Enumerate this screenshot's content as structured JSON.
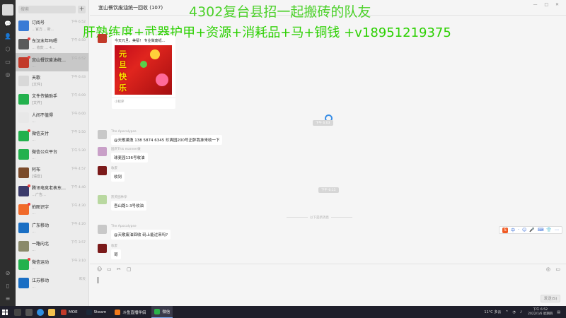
{
  "window": {
    "title": "宜山餐饮废油统一回收 (107)",
    "controls": "— □ ✕"
  },
  "overlays": {
    "line1": "4302复台县招一起搬砖的队友",
    "line2": "肝熟练度+武器护甲+资源+消耗品+马+铜钱 +v18951219375"
  },
  "rail": {
    "icons": [
      "chat-icon",
      "contacts-icon",
      "favorites-icon",
      "files-icon",
      "moments-icon"
    ],
    "bottom_icons": [
      "phone-icon",
      "settings-icon",
      "menu-icon"
    ]
  },
  "search": {
    "placeholder": "搜索",
    "add_label": "+"
  },
  "conversations": [
    {
      "name": "订阅号",
      "preview": "…官方… 新…",
      "time": "下午 6:52",
      "color": "#3a7bd5",
      "unread": false
    },
    {
      "name": "东汉末年吗嗯",
      "preview": "… 收款 … 4…",
      "time": "下午 6:50",
      "color": "#5a5a5a",
      "unread": true
    },
    {
      "name": "宜山餐饮废油统…",
      "preview": "…",
      "time": "下午 6:52",
      "color": "#c23a2a",
      "unread": true
    },
    {
      "name": "天歌",
      "preview": "[文件]",
      "time": "下午 6:43",
      "color": "#d8d8d8",
      "unread": false
    },
    {
      "name": "文件传输助手",
      "preview": "[文件]",
      "time": "下午 6:09",
      "color": "#23b14d",
      "unread": false
    },
    {
      "name": "人间不值得",
      "preview": "…",
      "time": "下午 6:00",
      "color": "#e8e8e8",
      "unread": false
    },
    {
      "name": "微信支付",
      "preview": "…",
      "time": "下午 5:50",
      "color": "#23b14d",
      "unread": true
    },
    {
      "name": "微信公众平台",
      "preview": "…",
      "time": "下午 5:30",
      "color": "#23b14d",
      "unread": false
    },
    {
      "name": "阿布",
      "preview": "[语音]",
      "time": "下午 4:57",
      "color": "#7b4b2a",
      "unread": false
    },
    {
      "name": "腾讯电竞老表东…",
      "preview": "…广告…",
      "time": "下午 4:40",
      "color": "#3b3b6b",
      "unread": true
    },
    {
      "name": "拍图识字",
      "preview": "…",
      "time": "下午 4:30",
      "color": "#f06a2a",
      "unread": true
    },
    {
      "name": "广东移动",
      "preview": "…",
      "time": "下午 4:20",
      "color": "#1a6fc4",
      "unread": false
    },
    {
      "name": "一路向北",
      "preview": "…",
      "time": "下午 3:57",
      "color": "#8a8a6a",
      "unread": false
    },
    {
      "name": "微信运动",
      "preview": "…",
      "time": "下午 3:10",
      "color": "#23b14d",
      "unread": true
    },
    {
      "name": "江苏移动",
      "preview": "…",
      "time": "昨天",
      "color": "#1a6fc4",
      "unread": false
    }
  ],
  "card": {
    "title": "今天元旦，美鄢！ 专业做废纸…",
    "chars": [
      "元",
      "旦",
      "快",
      "乐"
    ],
    "source": "小程序"
  },
  "messages": [
    {
      "sender": "The Apocalypse",
      "text": "@天歌袭渔 138 5874 6345 珍爽园200号正胖我抹来收一下",
      "avatar": "#c8c8c8"
    },
    {
      "sender": "国庆This manner做",
      "text": "球麦园136号收油",
      "avatar": "#c9a0c8"
    },
    {
      "sender": "收废",
      "text": "收到",
      "avatar": "#7b1a1a"
    },
    {
      "sender": "凯英园林亭",
      "text": "吾山路1-3号收油",
      "avatar": "#b9d8a0"
    },
    {
      "sender": "The Apocalypse",
      "text": "@天歌废油回收 码上能过来吗?",
      "avatar": "#c8c8c8"
    },
    {
      "sender": "收废",
      "text": "哥",
      "avatar": "#7b1a1a"
    }
  ],
  "time_labels": [
    "下午 6:03",
    "下午 6:11"
  ],
  "new_messages_divider": "以下是新消息",
  "ime": {
    "labels": [
      "中",
      "·",
      "☺",
      "🎤",
      "⌨",
      "👕",
      "⋯"
    ]
  },
  "toolbar": {
    "left_icons": [
      "emoji-icon",
      "folder-icon",
      "scissors-icon",
      "chat-history-icon"
    ],
    "right_icons": [
      "voice-call-icon",
      "video-call-icon"
    ]
  },
  "send_button": "发送(S)",
  "taskbar": {
    "apps": [
      {
        "label": "MOE",
        "color": "#c23a2a"
      },
      {
        "label": "Steam",
        "color": "#1b2838"
      },
      {
        "label": "斗鱼直播伴侣",
        "color": "#f27a1a"
      },
      {
        "label": "微信",
        "color": "#2ab34a",
        "active": true
      }
    ],
    "weather": "11°C 多云",
    "time": "下午 6:52",
    "date": "2022/1/6 星期四"
  }
}
